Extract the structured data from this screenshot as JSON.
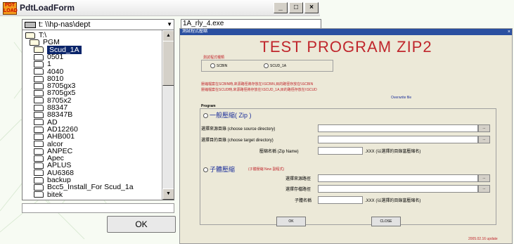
{
  "window": {
    "app_icon_text": "PDT\nLOAD",
    "title": "PdtLoadForm",
    "minimize": "_",
    "maximize": "□",
    "close": "×"
  },
  "drive": {
    "label": "t: \\\\hp-nas\\dept"
  },
  "filename": {
    "value": "1A_rly_4.exe"
  },
  "tree": {
    "items": [
      {
        "label": "T:\\",
        "level": 0,
        "open": true
      },
      {
        "label": "PGM",
        "level": 1,
        "open": true
      },
      {
        "label": "Scud_1A",
        "level": 2,
        "open": true,
        "selected": true
      },
      {
        "label": "0501",
        "level": 2
      },
      {
        "label": "1",
        "level": 2
      },
      {
        "label": "4040",
        "level": 2
      },
      {
        "label": "8010",
        "level": 2
      },
      {
        "label": "8705gx3",
        "level": 2
      },
      {
        "label": "8705gx5",
        "level": 2
      },
      {
        "label": "8705x2",
        "level": 2
      },
      {
        "label": "88347",
        "level": 2
      },
      {
        "label": "88347B",
        "level": 2
      },
      {
        "label": "AD",
        "level": 2
      },
      {
        "label": "AD12260",
        "level": 2
      },
      {
        "label": "AHB001",
        "level": 2
      },
      {
        "label": "alcor",
        "level": 2
      },
      {
        "label": "ANPEC",
        "level": 2
      },
      {
        "label": "Apec",
        "level": 2
      },
      {
        "label": "APLUS",
        "level": 2
      },
      {
        "label": "AU6368",
        "level": 2
      },
      {
        "label": "backup",
        "level": 2
      },
      {
        "label": "Bcc5_Install_For Scud_1a",
        "level": 2
      },
      {
        "label": "bitek",
        "level": 2
      }
    ],
    "scroll_up": "▲",
    "scroll_down": "▼"
  },
  "ok_button": {
    "label": "OK"
  },
  "embedded": {
    "titlebar": "測試程式壓縮",
    "close": "×",
    "heading": "TEST PROGRAM ZIP2",
    "section1": "測試程式種類",
    "radio1": "SCBIN",
    "radio2": "SCUD_1A",
    "note1": "壓縮檔案在SCBIN時,來源路徑將存放在\\\\SCBIN,目的路徑存放在\\\\SCBIN",
    "note2": "壓縮檔案在SCUD時,來源路徑將存放在\\\\SCUD_1A,目的路徑存放在\\\\SCUD",
    "overwrite": "Overwrite file",
    "program": "Program",
    "group1": "一般壓縮( Zip )",
    "src_label": "選擇來源目錄 (choose source directory)",
    "dst_label": "選擇目的目錄 (choose target directory)",
    "name_label": "壓縮名稱 (Zip Name)",
    "name_suffix": ".XXX (以選擇的目錄當壓縮名)",
    "group2": "子體壓縮",
    "group2_note": "(子體壓縮 New 副程式)",
    "sub_src": "選擇來源路徑",
    "sub_dst": "選擇存檔路徑",
    "sub_name": "子體名稱",
    "sub_suffix": ".XXX (以選擇的目錄當壓縮名)",
    "browse": "...",
    "ok": "OK",
    "close_btn": "CLOSE",
    "footer": "2005.02.16 update"
  }
}
